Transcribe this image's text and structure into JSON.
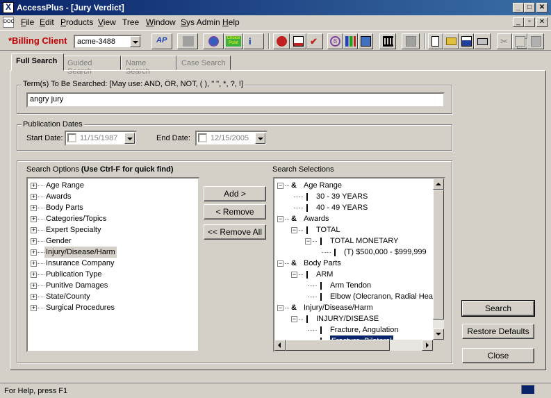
{
  "window": {
    "title": "AccessPlus - [Jury Verdict]",
    "minimize_label": "_",
    "restore_label": "▫",
    "close_label": "✕"
  },
  "menu": {
    "items": [
      {
        "label": "File",
        "accel": "F",
        "rest": "ile"
      },
      {
        "label": "Edit",
        "accel": "E",
        "rest": "dit"
      },
      {
        "label": "Products",
        "accel": "P",
        "rest": "roducts"
      },
      {
        "label": "View",
        "accel": "V",
        "rest": "iew"
      },
      {
        "label": "Tree",
        "accel": "",
        "rest": "Tree"
      },
      {
        "label": "Window",
        "accel": "W",
        "rest": "indow"
      },
      {
        "label": "Sys Admin",
        "accel": "S",
        "rest": "ys Admin"
      },
      {
        "label": "Help",
        "accel": "H",
        "rest": "elp"
      }
    ]
  },
  "toolbar": {
    "billing_label": "*Billing Client",
    "client_value": "acme-3488",
    "buttons": [
      "ap-icon",
      "juris-icon",
      "globe-icon",
      "choicepoint-icon",
      "info-icon",
      "owl-icon",
      "document-icon",
      "gavel-icon",
      "b-icon",
      "chart-icon",
      "photo-icon",
      "courthouse-icon",
      "printer-gray-icon",
      "new-icon",
      "open-icon",
      "save-icon",
      "print-icon",
      "cut-icon",
      "copy-icon",
      "paste-icon"
    ],
    "choice_point_text": "Choice Point"
  },
  "tabs": [
    {
      "label": "Full Search",
      "active": true
    },
    {
      "label": "Guided Search",
      "active": false
    },
    {
      "label": "Name Search",
      "active": false
    },
    {
      "label": "Case Search",
      "active": false
    }
  ],
  "terms": {
    "legend": "Term(s) To Be Searched: [May use: AND, OR, NOT, ( ), \" \", *, ?, !]",
    "value": "angry jury"
  },
  "dates": {
    "legend": "Publication Dates",
    "start_label": "Start Date:",
    "start_value": "11/15/1987",
    "end_label": "End Date:",
    "end_value": "12/15/2005"
  },
  "search_options": {
    "label": "Search Options",
    "hint": "(Use Ctrl-F for quick find)",
    "items": [
      "Age Range",
      "Awards",
      "Body Parts",
      "Categories/Topics",
      "Expert Specialty",
      "Gender",
      "Injury/Disease/Harm",
      "Insurance Company",
      "Publication Type",
      "Punitive Damages",
      "State/County",
      "Surgical Procedures"
    ],
    "selected_index": 6
  },
  "actions": {
    "add": "Add >",
    "remove": "< Remove",
    "remove_all": "<< Remove All"
  },
  "search_selections": {
    "label": "Search Selections",
    "nodes": [
      {
        "level": 0,
        "kind": "amp",
        "text": "Age Range",
        "expander": "−"
      },
      {
        "level": 1,
        "kind": "bar",
        "text": "30 - 39 YEARS",
        "expander": ""
      },
      {
        "level": 1,
        "kind": "bar",
        "text": "40 - 49 YEARS",
        "expander": ""
      },
      {
        "level": 0,
        "kind": "amp",
        "text": "Awards",
        "expander": "−"
      },
      {
        "level": 1,
        "kind": "bar",
        "text": "TOTAL",
        "expander": "−"
      },
      {
        "level": 2,
        "kind": "bar",
        "text": "TOTAL MONETARY",
        "expander": "−"
      },
      {
        "level": 3,
        "kind": "bar",
        "text": "(T) $500,000 - $999,999",
        "expander": ""
      },
      {
        "level": 0,
        "kind": "amp",
        "text": "Body Parts",
        "expander": "−"
      },
      {
        "level": 1,
        "kind": "bar",
        "text": "ARM",
        "expander": "−"
      },
      {
        "level": 2,
        "kind": "bar",
        "text": "Arm Tendon",
        "expander": ""
      },
      {
        "level": 2,
        "kind": "bar",
        "text": "Elbow (Olecranon, Radial Head)",
        "expander": ""
      },
      {
        "level": 0,
        "kind": "amp",
        "text": "Injury/Disease/Harm",
        "expander": "−"
      },
      {
        "level": 1,
        "kind": "bar",
        "text": "INJURY/DISEASE",
        "expander": "−"
      },
      {
        "level": 2,
        "kind": "bar",
        "text": "Fracture, Angulation",
        "expander": ""
      },
      {
        "level": 2,
        "kind": "bar",
        "text": "Fracture, Bilateral",
        "expander": "",
        "highlight": true
      }
    ]
  },
  "buttons": {
    "search": "Search",
    "restore_defaults": "Restore Defaults",
    "close": "Close"
  },
  "status": {
    "text": "For Help, press F1"
  },
  "colors": {
    "titlebar": "#0a246a",
    "billing": "#c00000",
    "face": "#d4d0c8"
  }
}
